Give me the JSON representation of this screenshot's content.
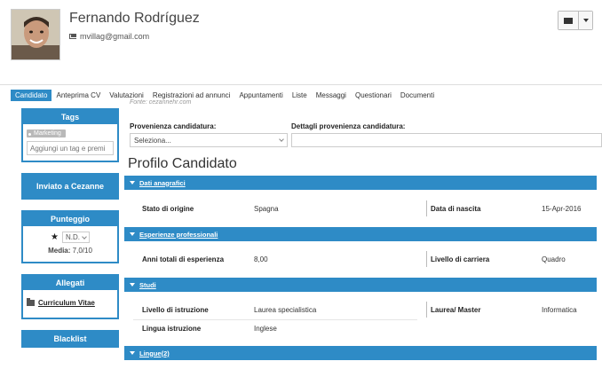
{
  "header": {
    "name": "Fernando Rodríguez",
    "email": "mvillag@gmail.com"
  },
  "tabs": [
    {
      "label": "Candidato",
      "active": true
    },
    {
      "label": "Anteprima CV"
    },
    {
      "label": "Valutazioni"
    },
    {
      "label": "Registrazioni ad annunci"
    },
    {
      "label": "Appuntamenti"
    },
    {
      "label": "Liste"
    },
    {
      "label": "Messaggi"
    },
    {
      "label": "Questionari"
    },
    {
      "label": "Documenti"
    }
  ],
  "sidebar": {
    "tags": {
      "title": "Tags",
      "chip": "Marketing",
      "placeholder": "Aggiungi un tag e premi"
    },
    "send_button": "Inviato a Cezanne",
    "score": {
      "title": "Punteggio",
      "value": "N.D.",
      "media_label": "Media:",
      "media_value": "7,0/10"
    },
    "attachments": {
      "title": "Allegati",
      "link": "Curriculum Vitae"
    },
    "blacklist": {
      "title": "Blacklist"
    }
  },
  "main": {
    "fonte": "Fonte: cezannehr.com",
    "provenienza_label": "Provenienza candidatura:",
    "provenienza_value": "Seleziona...",
    "dettagli_label": "Dettagli provenienza candidatura:",
    "title": "Profilo Candidato",
    "sections": {
      "dati": {
        "label": "Dati anagrafici",
        "stato_k": "Stato di origine",
        "stato_v": "Spagna",
        "nascita_k": "Data di nascita",
        "nascita_v": "15-Apr-2016"
      },
      "esperienze": {
        "label": "Esperienze professionali",
        "anni_k": "Anni totali di esperienza",
        "anni_v": "8,00",
        "livello_k": "Livello di carriera",
        "livello_v": "Quadro"
      },
      "studi": {
        "label": "Studi",
        "istr_k": "Livello di istruzione",
        "istr_v": "Laurea specialistica",
        "laurea_k": "Laurea/ Master",
        "laurea_v": "Informatica",
        "lingua_k": "Lingua istruzione",
        "lingua_v": "Inglese"
      },
      "lingue": {
        "label": "Lingue(2)"
      }
    }
  }
}
